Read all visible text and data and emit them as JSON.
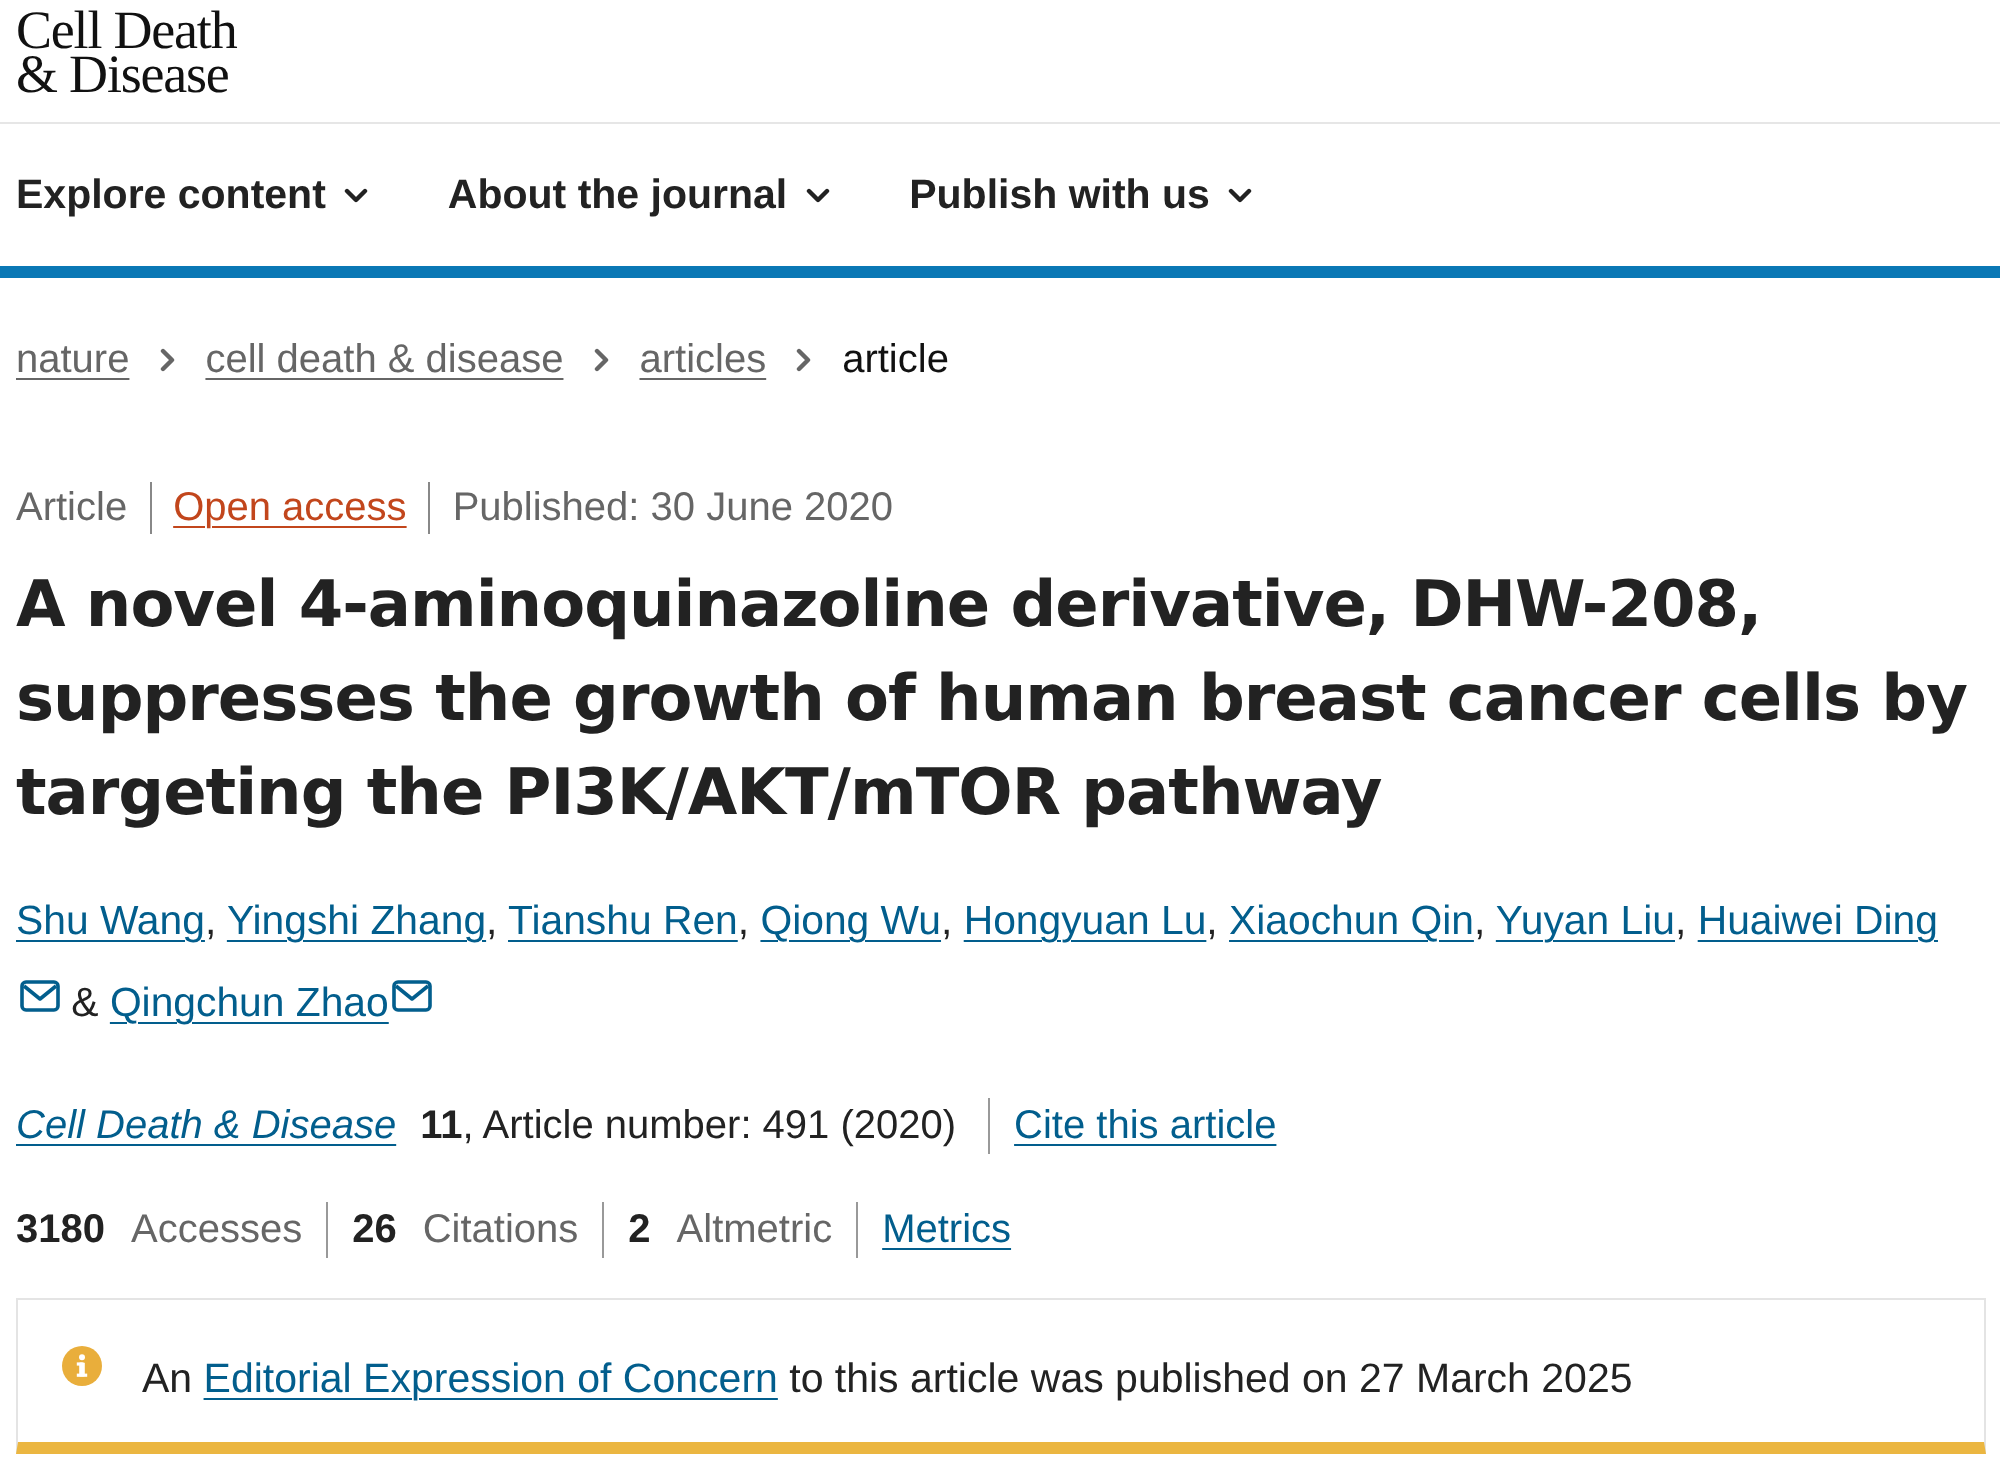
{
  "logo": {
    "line_1": "Cell Death",
    "line_2": "& Disease"
  },
  "nav": [
    {
      "label": "Explore content"
    },
    {
      "label": "About the journal"
    },
    {
      "label": "Publish with us"
    }
  ],
  "breadcrumbs": [
    {
      "label": "nature",
      "kind": "link"
    },
    {
      "label": "cell death & disease",
      "kind": "link"
    },
    {
      "label": "articles",
      "kind": "link"
    },
    {
      "label": "article",
      "kind": "current"
    }
  ],
  "article_meta": [
    {
      "label": "Article",
      "kind": "text"
    },
    {
      "label": "Open access",
      "kind": "access_link"
    },
    {
      "label": "Published: 30 June 2020",
      "kind": "text"
    }
  ],
  "title": "A novel 4-aminoquinazoline derivative, DHW-208, suppresses the growth of human breast cancer cells by targeting the PI3K/AKT/mTOR pathway",
  "authors": [
    {
      "name": "Shu Wang",
      "email": false,
      "separator": ","
    },
    {
      "name": "Yingshi Zhang",
      "email": false,
      "separator": ","
    },
    {
      "name": "Tianshu Ren",
      "email": false,
      "separator": ","
    },
    {
      "name": "Qiong Wu",
      "email": false,
      "separator": ","
    },
    {
      "name": "Hongyuan Lu",
      "email": false,
      "separator": ","
    },
    {
      "name": "Xiaochun Qin",
      "email": false,
      "separator": ","
    },
    {
      "name": "Yuyan Liu",
      "email": false,
      "separator": ","
    },
    {
      "name": "Huaiwei Ding",
      "email": true,
      "separator": "&"
    },
    {
      "name": "Qingchun Zhao",
      "email": true
    }
  ],
  "citation": {
    "journal": "Cell Death & Disease",
    "details": "**11**, Article number: 491 (2020)",
    "cite_link": "Cite this article"
  },
  "metrics": [
    {
      "kind": "count",
      "count": "3180",
      "name": "Accesses"
    },
    {
      "kind": "count",
      "count": "26",
      "name": "Citations"
    },
    {
      "kind": "count",
      "count": "2",
      "name": "Altmetric"
    },
    {
      "kind": "link",
      "name": "Metrics"
    }
  ],
  "notice": {
    "text_before": "An",
    "link": "Editorial Expression of Concern",
    "text_after": "to this article was published on 27 March 2025"
  }
}
